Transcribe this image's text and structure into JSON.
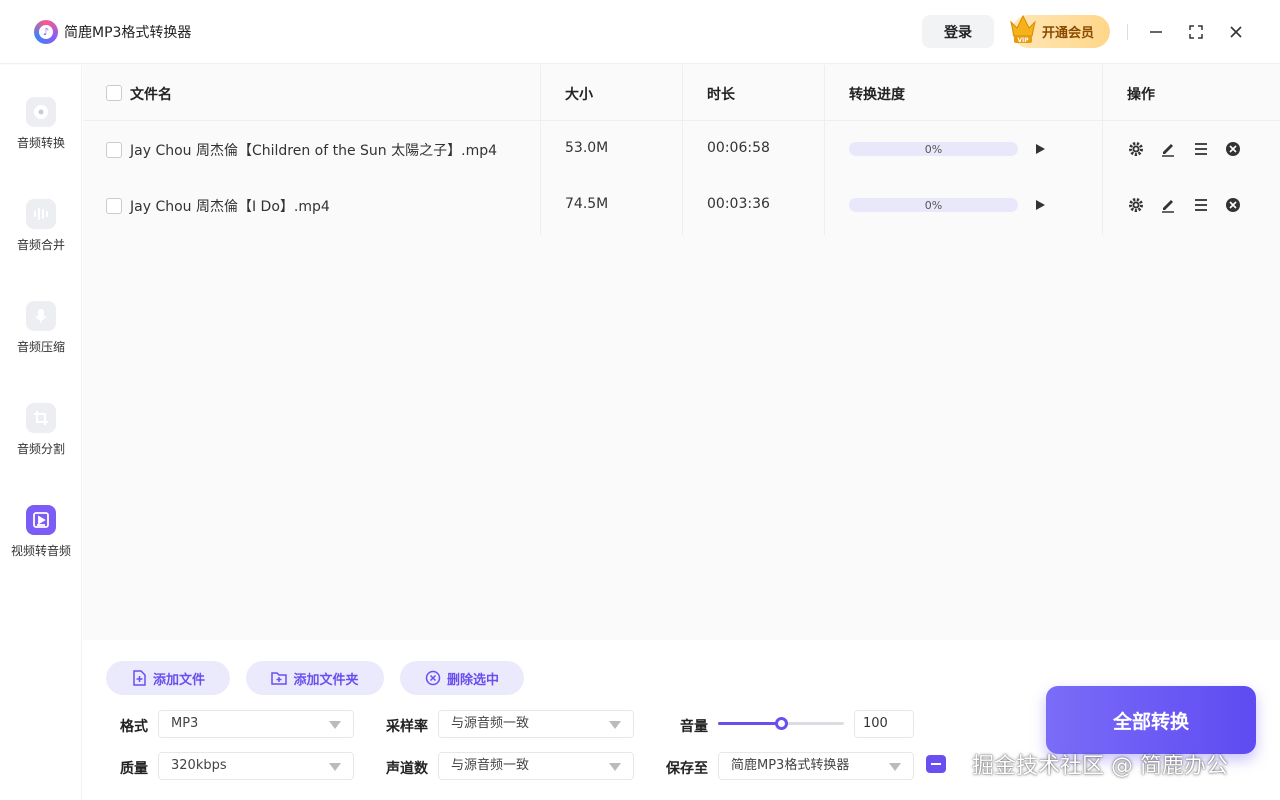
{
  "app": {
    "title": "简鹿MP3格式转换器",
    "login_label": "登录",
    "vip_label": "开通会员"
  },
  "sidebar": {
    "items": [
      {
        "label": "音频转换",
        "icon": "disc-icon",
        "active": false
      },
      {
        "label": "音频合并",
        "icon": "waveform-icon",
        "active": false
      },
      {
        "label": "音频压缩",
        "icon": "microphone-icon",
        "active": false
      },
      {
        "label": "音频分割",
        "icon": "crop-icon",
        "active": false
      },
      {
        "label": "视频转音频",
        "icon": "video-audio-icon",
        "active": true
      }
    ]
  },
  "table": {
    "headers": {
      "filename": "文件名",
      "size": "大小",
      "duration": "时长",
      "progress": "转换进度",
      "actions": "操作"
    },
    "rows": [
      {
        "filename": "Jay Chou 周杰倫【Children of the Sun 太陽之子】.mp4",
        "size": "53.0M",
        "duration": "00:06:58",
        "progress": 0,
        "progress_text": "0%"
      },
      {
        "filename": "Jay Chou 周杰倫【I Do】.mp4",
        "size": "74.5M",
        "duration": "00:03:36",
        "progress": 0,
        "progress_text": "0%"
      }
    ]
  },
  "toolbar": {
    "add_file": "添加文件",
    "add_folder": "添加文件夹",
    "delete_selected": "删除选中"
  },
  "settings": {
    "format_label": "格式",
    "format_value": "MP3",
    "quality_label": "质量",
    "quality_value": "320kbps",
    "samplerate_label": "采样率",
    "samplerate_value": "与源音频一致",
    "channels_label": "声道数",
    "channels_value": "与源音频一致",
    "volume_label": "音量",
    "volume_value": "100",
    "volume_level": 0.5,
    "save_label": "保存至",
    "save_value": "简鹿MP3格式转换器"
  },
  "convert_all_label": "全部转换",
  "watermark": "掘金技术社区 @ 简鹿办公",
  "colors": {
    "accent": "#6a4ff0",
    "accent_light": "#ebeafc",
    "vip_gold": "#ffd68a"
  }
}
